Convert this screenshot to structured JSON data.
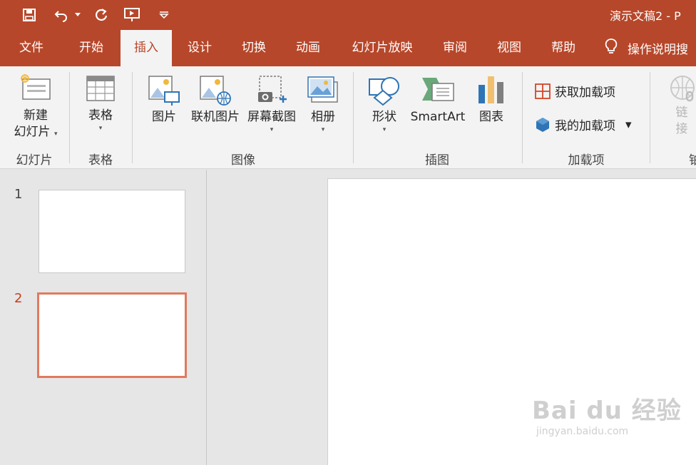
{
  "title_bar": {
    "document_title": "演示文稿2  -  P",
    "quick_access": [
      {
        "icon": "save-icon"
      },
      {
        "icon": "undo-icon"
      },
      {
        "icon": "undo-dropdown-icon"
      },
      {
        "icon": "redo-icon"
      },
      {
        "icon": "present-from-beginning-icon"
      },
      {
        "icon": "customize-qat-icon"
      }
    ]
  },
  "tabs": [
    {
      "label": "文件"
    },
    {
      "label": "开始"
    },
    {
      "label": "插入",
      "active": true
    },
    {
      "label": "设计"
    },
    {
      "label": "切换"
    },
    {
      "label": "动画"
    },
    {
      "label": "幻灯片放映"
    },
    {
      "label": "审阅"
    },
    {
      "label": "视图"
    },
    {
      "label": "帮助"
    }
  ],
  "tell_me": {
    "label": "操作说明搜",
    "icon": "lightbulb-icon"
  },
  "ribbon": {
    "new_slide": {
      "line1": "新建",
      "line2": "幻灯片",
      "caret": "▾"
    },
    "table": {
      "label": "表格",
      "caret": "▾"
    },
    "pictures": {
      "label": "图片"
    },
    "online_pictures": {
      "label": "联机图片"
    },
    "screenshot": {
      "label": "屏幕截图",
      "caret": "▾"
    },
    "album": {
      "label": "相册",
      "caret": "▾"
    },
    "shapes": {
      "label": "形状",
      "caret": "▾"
    },
    "smartart": {
      "label": "SmartArt"
    },
    "chart": {
      "label": "图表"
    },
    "get_addins": {
      "label": "获取加载项"
    },
    "my_addins": {
      "label": "我的加载项",
      "caret": "▾"
    },
    "link": {
      "line1": "链",
      "line2": "接"
    },
    "groups": {
      "slides": "幻灯片",
      "tables": "表格",
      "images": "图像",
      "illustrations": "插图",
      "addins": "加载项",
      "links_partial": "铂"
    }
  },
  "slides": [
    {
      "number": "1"
    },
    {
      "number": "2",
      "selected": true
    }
  ],
  "watermark": {
    "main": "Bai du 经验",
    "sub": "jingyan.baidu.com"
  },
  "colors": {
    "accent": "#b7472a",
    "selected_slide": "#e07a5f"
  }
}
